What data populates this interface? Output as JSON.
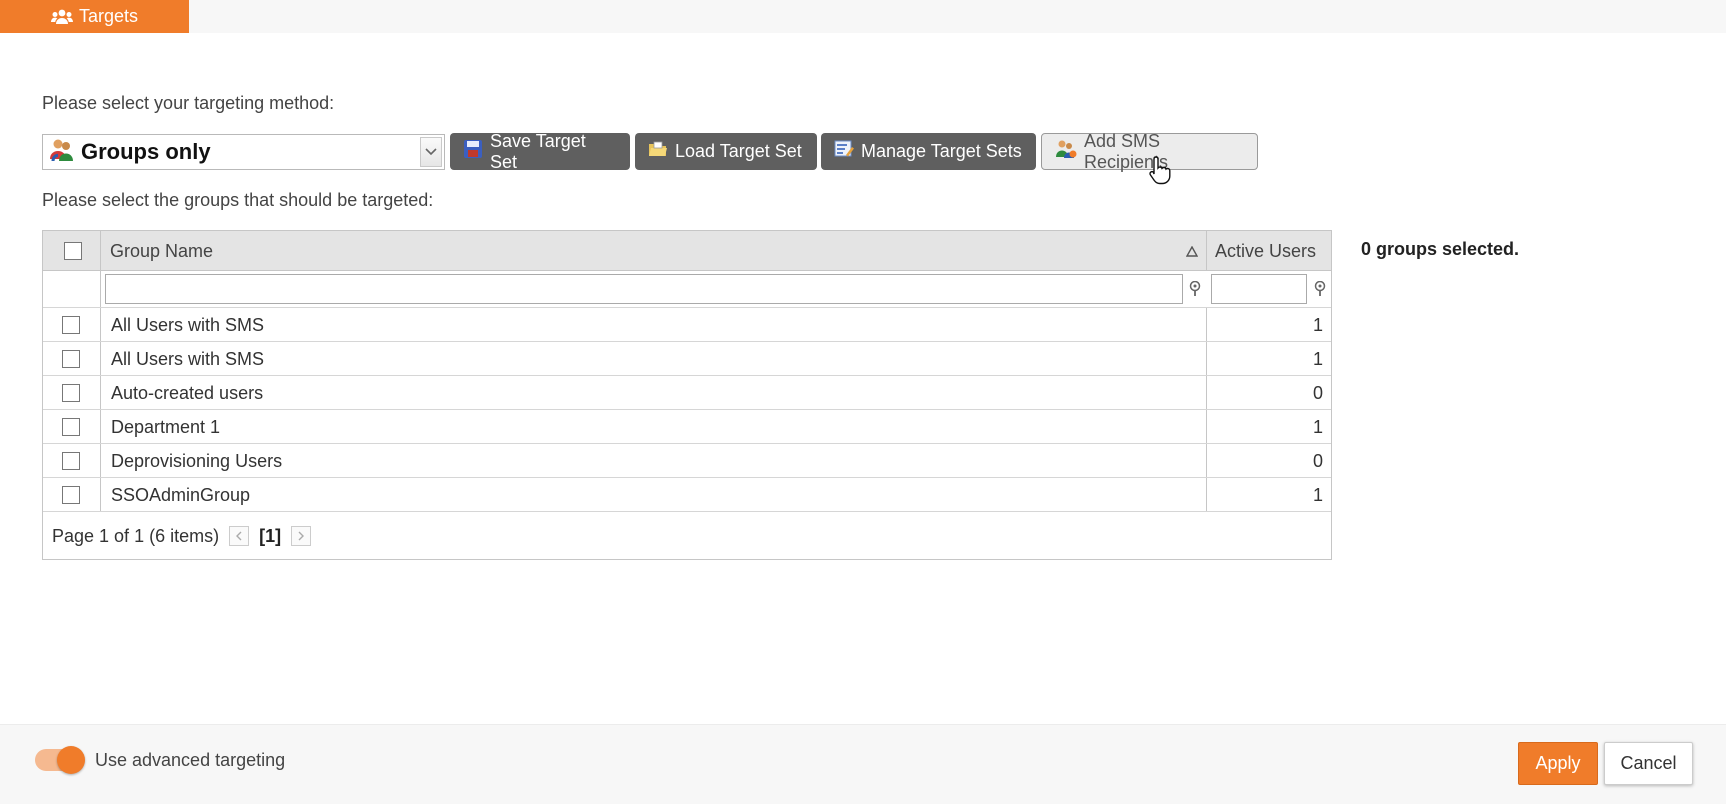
{
  "header": {
    "tab_label": "Targets",
    "tab_icon": "users-icon",
    "accent_color": "#f07c2a"
  },
  "targeting": {
    "method_prompt": "Please select your targeting method:",
    "method_value": "Groups only",
    "groups_prompt": "Please select the groups that should be targeted:"
  },
  "toolbar": {
    "save_label": "Save Target Set",
    "load_label": "Load Target Set",
    "manage_label": "Manage Target Sets",
    "sms_label": "Add SMS Recipients"
  },
  "grid": {
    "columns": [
      "Group Name",
      "Active Users"
    ],
    "rows": [
      {
        "name": "All Users with SMS",
        "active_users": "1"
      },
      {
        "name": "All Users with SMS",
        "active_users": "1"
      },
      {
        "name": "Auto-created users",
        "active_users": "0"
      },
      {
        "name": "Department 1",
        "active_users": "1"
      },
      {
        "name": "Deprovisioning Users",
        "active_users": "0"
      },
      {
        "name": "SSOAdminGroup",
        "active_users": "1"
      }
    ],
    "pager_text": "Page 1 of 1 (6 items)",
    "current_page": "[1]"
  },
  "selection_summary": "0 groups selected.",
  "footer": {
    "advanced_label": "Use advanced targeting",
    "advanced_enabled": true,
    "apply_label": "Apply",
    "cancel_label": "Cancel"
  }
}
